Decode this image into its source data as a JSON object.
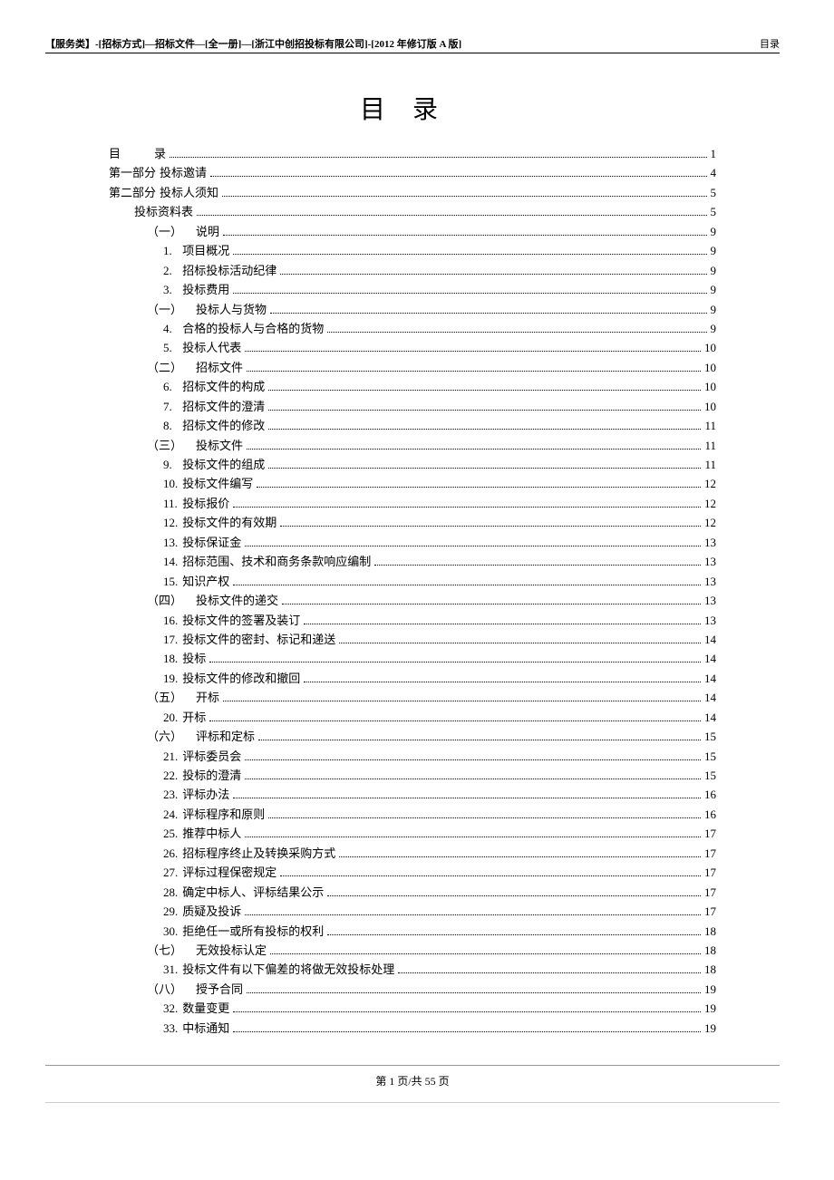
{
  "header": {
    "left": "【服务类】-[招标方式]—招标文件—[全一册]—[浙江中创招投标有限公司]-[2012 年修订版 A 版]",
    "right": "目录"
  },
  "title": "目录",
  "toc": [
    {
      "indent": 1,
      "label": "目",
      "label2": "录",
      "page": "1",
      "spaced": true
    },
    {
      "indent": 1,
      "label": "第一部分",
      "label2": "投标邀请",
      "page": "4"
    },
    {
      "indent": 1,
      "label": "第二部分",
      "label2": "投标人须知",
      "page": "5"
    },
    {
      "indent": 2,
      "label": "投标资料表",
      "page": "5"
    },
    {
      "indent": 3,
      "label": "（一）",
      "label2": "说明",
      "page": "9",
      "gap": true
    },
    {
      "indent": 4,
      "label": "1.",
      "label2": "项目概况",
      "page": "9"
    },
    {
      "indent": 4,
      "label": "2.",
      "label2": "招标投标活动纪律",
      "page": "9"
    },
    {
      "indent": 4,
      "label": "3.",
      "label2": "投标费用",
      "page": "9"
    },
    {
      "indent": 3,
      "label": "（一）",
      "label2": "投标人与货物",
      "page": "9",
      "gap": true
    },
    {
      "indent": 4,
      "label": "4.",
      "label2": "合格的投标人与合格的货物",
      "page": "9"
    },
    {
      "indent": 4,
      "label": "5.",
      "label2": "投标人代表",
      "page": "10"
    },
    {
      "indent": 3,
      "label": "（二）",
      "label2": "招标文件",
      "page": "10",
      "gap": true
    },
    {
      "indent": 4,
      "label": "6.",
      "label2": "招标文件的构成",
      "page": "10"
    },
    {
      "indent": 4,
      "label": "7.",
      "label2": "招标文件的澄清",
      "page": "10"
    },
    {
      "indent": 4,
      "label": "8.",
      "label2": "招标文件的修改",
      "page": "11"
    },
    {
      "indent": 3,
      "label": "（三）",
      "label2": "投标文件",
      "page": "11",
      "gap": true
    },
    {
      "indent": 4,
      "label": "9.",
      "label2": "投标文件的组成",
      "page": "11"
    },
    {
      "indent": 4,
      "label": "10.",
      "label2": "投标文件编写",
      "page": "12"
    },
    {
      "indent": 4,
      "label": "11.",
      "label2": "投标报价",
      "page": "12"
    },
    {
      "indent": 4,
      "label": "12.",
      "label2": "投标文件的有效期",
      "page": "12"
    },
    {
      "indent": 4,
      "label": "13.",
      "label2": "投标保证金",
      "page": "13"
    },
    {
      "indent": 4,
      "label": "14.",
      "label2": "招标范围、技术和商务条款响应编制",
      "page": "13"
    },
    {
      "indent": 4,
      "label": "15.",
      "label2": "知识产权",
      "page": "13"
    },
    {
      "indent": 3,
      "label": "（四）",
      "label2": "投标文件的递交",
      "page": "13",
      "gap": true
    },
    {
      "indent": 4,
      "label": "16.",
      "label2": "投标文件的签署及装订",
      "page": "13"
    },
    {
      "indent": 4,
      "label": "17.",
      "label2": "投标文件的密封、标记和递送",
      "page": "14"
    },
    {
      "indent": 4,
      "label": "18.",
      "label2": "投标",
      "page": "14"
    },
    {
      "indent": 4,
      "label": "19.",
      "label2": "投标文件的修改和撤回",
      "page": "14"
    },
    {
      "indent": 3,
      "label": "（五）",
      "label2": "开标",
      "page": "14",
      "gap": true
    },
    {
      "indent": 4,
      "label": "20.",
      "label2": "开标",
      "page": "14"
    },
    {
      "indent": 3,
      "label": "（六）",
      "label2": "评标和定标",
      "page": "15",
      "gap": true
    },
    {
      "indent": 4,
      "label": "21.",
      "label2": "评标委员会",
      "page": "15"
    },
    {
      "indent": 4,
      "label": "22.",
      "label2": "投标的澄清",
      "page": "15"
    },
    {
      "indent": 4,
      "label": "23.",
      "label2": "评标办法",
      "page": "16"
    },
    {
      "indent": 4,
      "label": "24.",
      "label2": "评标程序和原则",
      "page": "16"
    },
    {
      "indent": 4,
      "label": "25.",
      "label2": "推荐中标人",
      "page": "17"
    },
    {
      "indent": 4,
      "label": "26.",
      "label2": "招标程序终止及转换采购方式",
      "page": "17"
    },
    {
      "indent": 4,
      "label": "27.",
      "label2": "评标过程保密规定",
      "page": "17"
    },
    {
      "indent": 4,
      "label": "28.",
      "label2": "确定中标人、评标结果公示",
      "page": "17"
    },
    {
      "indent": 4,
      "label": "29.",
      "label2": "质疑及投诉",
      "page": "17"
    },
    {
      "indent": 4,
      "label": "30.",
      "label2": "拒绝任一或所有投标的权利",
      "page": "18"
    },
    {
      "indent": 3,
      "label": "（七）",
      "label2": "无效投标认定",
      "page": "18",
      "gap": true
    },
    {
      "indent": 4,
      "label": "31.",
      "label2": "投标文件有以下偏差的将做无效投标处理",
      "page": "18"
    },
    {
      "indent": 3,
      "label": "（八）",
      "label2": "授予合同",
      "page": "19",
      "gap": true
    },
    {
      "indent": 4,
      "label": "32.",
      "label2": "数量变更",
      "page": "19"
    },
    {
      "indent": 4,
      "label": "33.",
      "label2": "中标通知",
      "page": "19"
    }
  ],
  "footer": {
    "page_text": "第 1 页/共 55 页"
  }
}
